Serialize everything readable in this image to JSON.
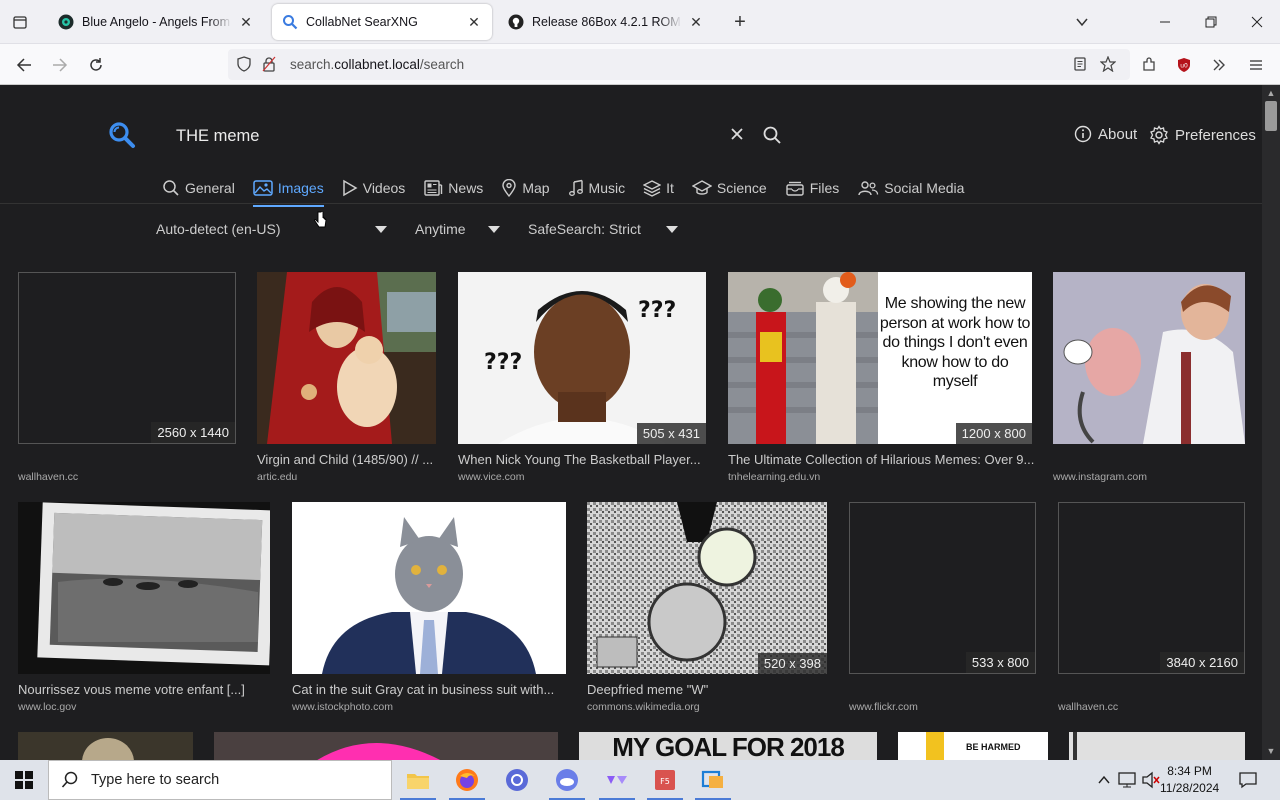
{
  "browser": {
    "tabs": [
      {
        "title": "Blue Angelo - Angels From The Secret",
        "active": false
      },
      {
        "title": "CollabNet SearXNG",
        "active": true
      },
      {
        "title": "Release 86Box 4.2.1 ROM set · 86Box/roms",
        "active": false
      }
    ],
    "url_prefix": "search.",
    "url_domain": "collabnet.local",
    "url_path": "/search"
  },
  "search": {
    "query": "THE meme",
    "about_label": "About",
    "preferences_label": "Preferences",
    "categories": [
      {
        "label": "General",
        "icon": "search-icon",
        "active": false
      },
      {
        "label": "Images",
        "icon": "image-icon",
        "active": true
      },
      {
        "label": "Videos",
        "icon": "play-icon",
        "active": false
      },
      {
        "label": "News",
        "icon": "newspaper-icon",
        "active": false
      },
      {
        "label": "Map",
        "icon": "map-pin-icon",
        "active": false
      },
      {
        "label": "Music",
        "icon": "music-note-icon",
        "active": false
      },
      {
        "label": "It",
        "icon": "layers-icon",
        "active": false
      },
      {
        "label": "Science",
        "icon": "school-icon",
        "active": false
      },
      {
        "label": "Files",
        "icon": "file-tray-icon",
        "active": false
      },
      {
        "label": "Social Media",
        "icon": "people-icon",
        "active": false
      }
    ],
    "filters": {
      "language": "Auto-detect (en-US)",
      "time": "Anytime",
      "safesearch": "SafeSearch: Strict"
    }
  },
  "results": [
    {
      "title": "",
      "source": "wallhaven.cc",
      "dims": "2560 x 1440"
    },
    {
      "title": "Virgin and Child (1485/90) // ...",
      "source": "artic.edu",
      "dims": ""
    },
    {
      "title": "When Nick Young The Basketball Player...",
      "source": "www.vice.com",
      "dims": "505 x 431",
      "overlay": "???"
    },
    {
      "title": "The Ultimate Collection of Hilarious Memes: Over 9...",
      "source": "tnhelearning.edu.vn",
      "dims": "1200 x 800",
      "overlay": "Me showing the new person at work how to do things I don't even know how to do myself"
    },
    {
      "title": "",
      "source": "www.instagram.com",
      "dims": ""
    },
    {
      "title": "Nourrissez vous meme votre enfant [...]",
      "source": "www.loc.gov",
      "dims": ""
    },
    {
      "title": "Cat in the suit Gray cat in business suit with...",
      "source": "www.istockphoto.com",
      "dims": ""
    },
    {
      "title": "Deepfried meme \"W\"",
      "source": "commons.wikimedia.org",
      "dims": "520 x 398"
    },
    {
      "title": "",
      "source": "www.flickr.com",
      "dims": "533 x 800"
    },
    {
      "title": "",
      "source": "wallhaven.cc",
      "dims": "3840 x 2160"
    },
    {
      "title": "",
      "source": "",
      "dims": "",
      "overlay": "MY GOAL FOR 2018"
    },
    {
      "title": "",
      "source": "",
      "dims": "",
      "overlay": "BE HARMED"
    }
  ],
  "taskbar": {
    "search_placeholder": "Type here to search",
    "time": "8:34 PM",
    "date": "11/28/2024"
  },
  "colors": {
    "accent": "#5fa9ff",
    "page_bg": "#1e1e20"
  }
}
